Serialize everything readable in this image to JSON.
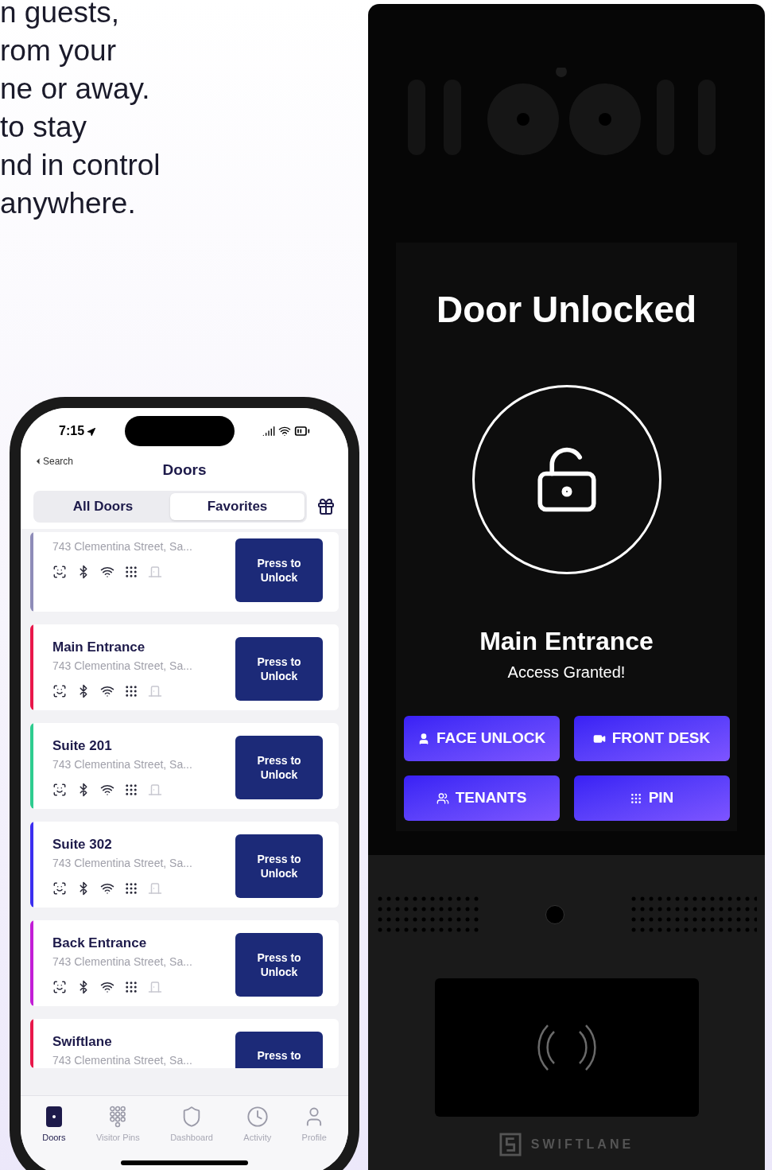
{
  "headline_lines": [
    "n guests,",
    "rom your",
    "ne or away.",
    " to stay",
    "nd in control",
    "anywhere."
  ],
  "phone": {
    "time": "7:15",
    "back": "Search",
    "title": "Doors",
    "tabs": [
      {
        "label": "All Doors",
        "selected": false
      },
      {
        "label": "Favorites",
        "selected": true
      }
    ],
    "doors": [
      {
        "address": "743 Clementina Street, Sa...",
        "button": "Press to Unlock",
        "color": "#8e8cb8"
      },
      {
        "name": "Main Entrance",
        "address": "743 Clementina Street, Sa...",
        "button": "Press to Unlock",
        "color": "#e8174a"
      },
      {
        "name": "Suite 201",
        "address": "743 Clementina Street, Sa...",
        "button": "Press to Unlock",
        "color": "#2ecc8f"
      },
      {
        "name": "Suite 302",
        "address": "743 Clementina Street, Sa...",
        "button": "Press to Unlock",
        "color": "#3b2ef0"
      },
      {
        "name": "Back Entrance",
        "address": "743 Clementina Street, Sa...",
        "button": "Press to Unlock",
        "color": "#c21ed6"
      },
      {
        "name": "Swiftlane",
        "address": "743 Clementina Street, Sa...",
        "button": "Press to",
        "color": "#e8174a"
      }
    ],
    "tab_bar": [
      {
        "kind": "door",
        "label": "Doors",
        "selected": true
      },
      {
        "kind": "keypad",
        "label": "Visitor Pins",
        "selected": false
      },
      {
        "kind": "shield",
        "label": "Dashboard",
        "selected": false
      },
      {
        "kind": "clock",
        "label": "Activity",
        "selected": false
      },
      {
        "kind": "person",
        "label": "Profile",
        "selected": false
      }
    ]
  },
  "device": {
    "status": "Door Unlocked",
    "door_name": "Main Entrance",
    "message": "Access Granted!",
    "buttons": [
      {
        "kind": "face",
        "label": "FACE UNLOCK"
      },
      {
        "kind": "video",
        "label": "FRONT DESK"
      },
      {
        "kind": "tenants",
        "label": "TENANTS"
      },
      {
        "kind": "pin",
        "label": "PIN"
      }
    ],
    "brand": "SWIFTLANE"
  }
}
